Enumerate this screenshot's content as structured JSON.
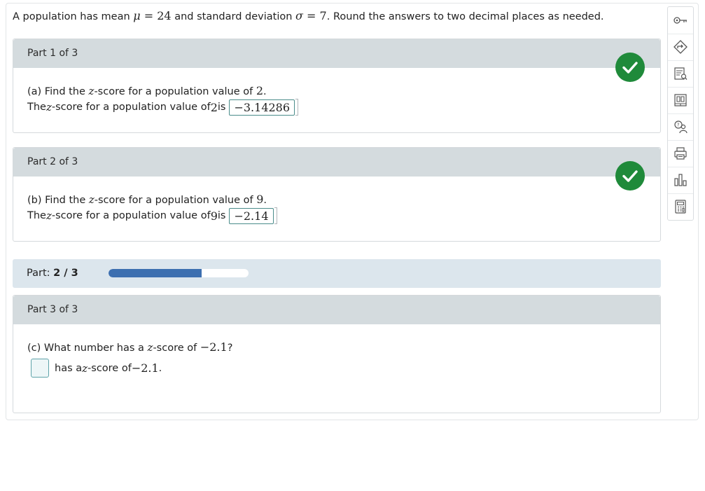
{
  "prompt": {
    "text_1": "A population has mean ",
    "mu_symbol": "μ",
    "mu_eq": " = 24",
    "text_2": " and standard deviation ",
    "sigma_symbol": "σ",
    "sigma_eq": " = 7",
    "text_3": ". Round the answers to two decimal places as needed."
  },
  "parts": [
    {
      "header": "Part 1 of 3",
      "question_prefix": "(a) Find the ",
      "z": "z",
      "question_mid": "-score for a population value of ",
      "question_value": "2",
      "question_suffix": ".",
      "answer_prefix": "The ",
      "answer_mid": "-score for a population value of ",
      "answer_value": "2",
      "answer_is": " is",
      "answer": "−3.14286",
      "answer_suffix": ".",
      "status": "correct"
    },
    {
      "header": "Part 2 of 3",
      "question_prefix": "(b) Find the ",
      "z": "z",
      "question_mid": "-score for a population value of ",
      "question_value": "9",
      "question_suffix": ".",
      "answer_prefix": "The ",
      "answer_mid": "-score for a population value of ",
      "answer_value": "9",
      "answer_is": " is",
      "answer": "−2.14",
      "answer_suffix": ".",
      "status": "correct"
    },
    {
      "header": "Part 3 of 3",
      "question_prefix": "(c) What number has a ",
      "z": "z",
      "question_mid": "-score of ",
      "question_value": "−2.1",
      "question_suffix": "?",
      "answer_text_1": "has a ",
      "answer_text_2": "-score of ",
      "answer_value": "−2.1",
      "answer_suffix": ".",
      "answer": ""
    }
  ],
  "progress": {
    "label": "Part: ",
    "current": "2",
    "sep": " / ",
    "total": "3",
    "fraction": 0.6667
  },
  "colors": {
    "check_green": "#1f8a3a",
    "progress_blue": "#3d6fb0",
    "header_gray": "#d4dbde",
    "progress_bg": "#dce6ed"
  },
  "toolbar": {
    "icons": [
      "key-icon",
      "guide-diamond-icon",
      "list-search-icon",
      "textbook-icon",
      "help-person-icon",
      "print-icon",
      "bar-chart-icon",
      "calculator-icon"
    ]
  }
}
